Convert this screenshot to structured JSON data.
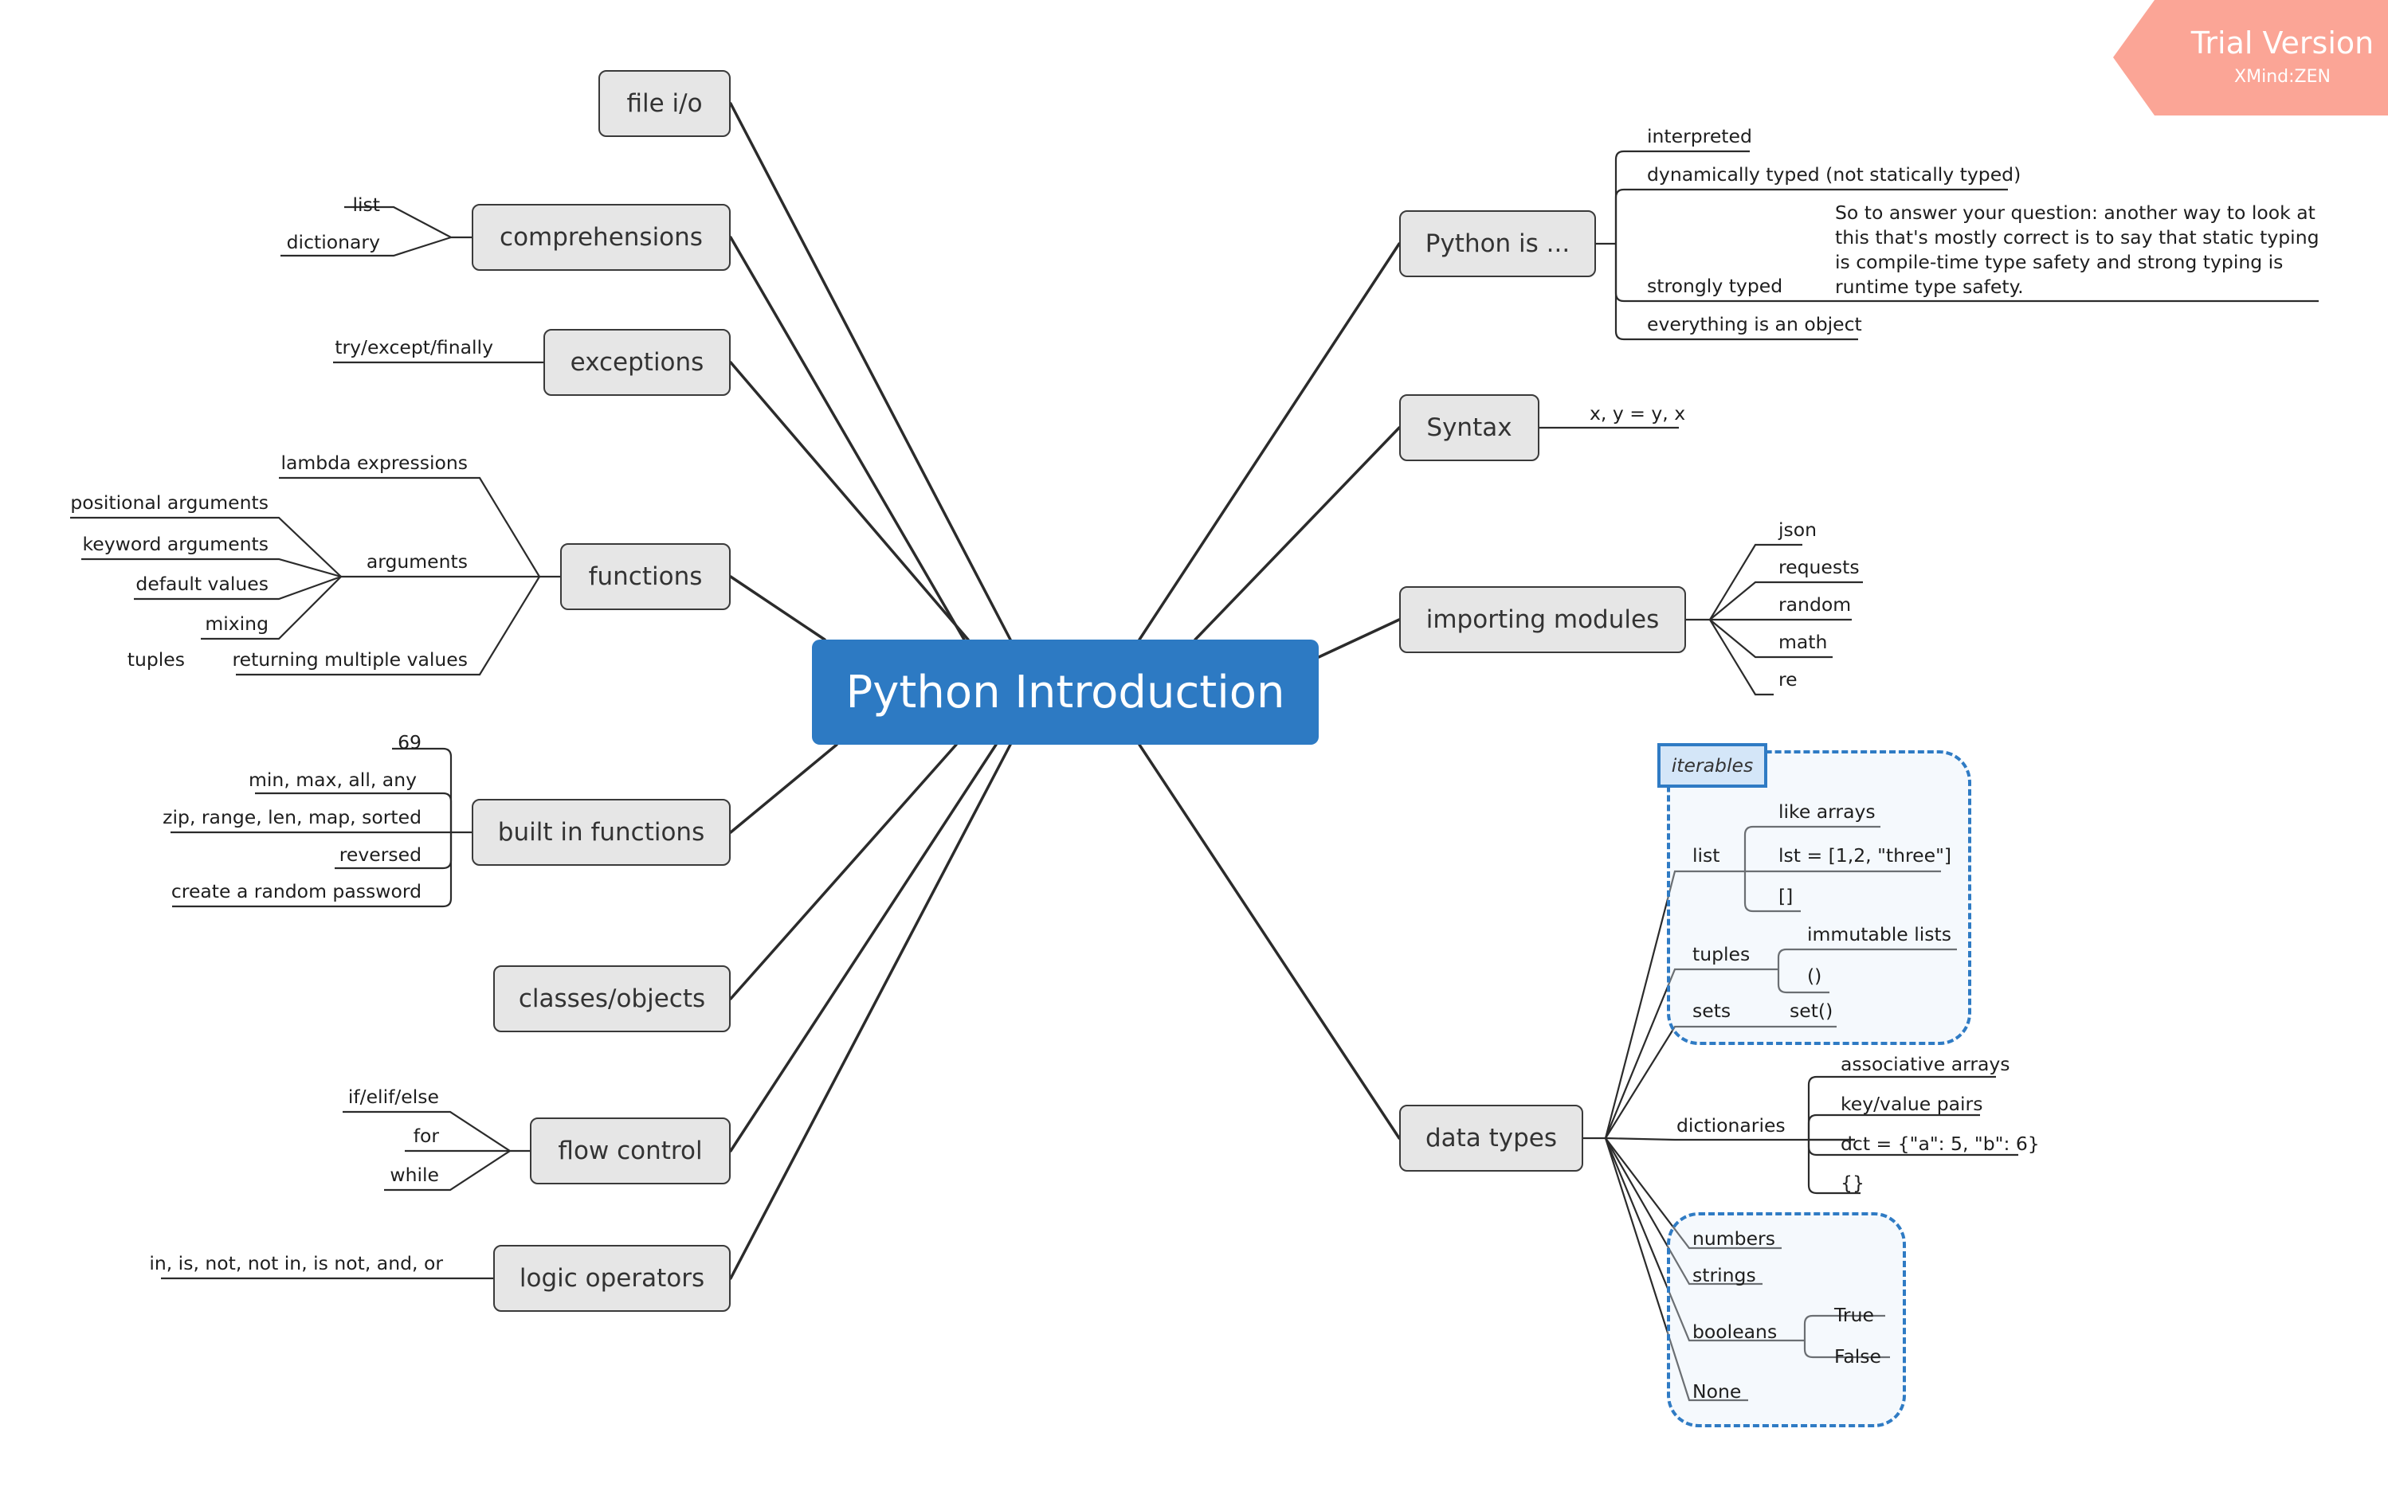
{
  "watermark": {
    "title": "Trial Version",
    "subtitle": "XMind:ZEN",
    "color": "#fba596"
  },
  "central": {
    "label": "Python Introduction",
    "color": "#2d7ac3"
  },
  "left_topics": {
    "file_io": {
      "label": "file i/o"
    },
    "comprehensions": {
      "label": "comprehensions",
      "children": [
        "list",
        "dictionary"
      ]
    },
    "exceptions": {
      "label": "exceptions",
      "children": [
        "try/except/finally"
      ]
    },
    "functions": {
      "label": "functions",
      "children": {
        "lambda": "lambda expressions",
        "arguments": {
          "label": "arguments",
          "children": [
            "positional arguments",
            "keyword arguments",
            "default values",
            "mixing"
          ]
        },
        "returning": {
          "label": "returning multiple values",
          "children": [
            "tuples"
          ]
        }
      }
    },
    "built_in": {
      "label": "built in functions",
      "children": [
        "69",
        "min, max, all, any",
        "zip, range, len, map, sorted",
        "reversed",
        "create a random password"
      ]
    },
    "classes": {
      "label": "classes/objects"
    },
    "flow_control": {
      "label": "flow control",
      "children": [
        "if/elif/else",
        "for",
        "while"
      ]
    },
    "logic": {
      "label": "logic operators",
      "children": [
        "in, is, not, not in, is not, and, or"
      ]
    }
  },
  "right_topics": {
    "python_is": {
      "label": "Python is ...",
      "children": {
        "interpreted": "interpreted",
        "dynamic": "dynamically typed (not statically typed)",
        "strong": "strongly typed",
        "strong_note": "So to answer your question: another way to look at this that's mostly correct is to say that static typing is compile-time type safety and strong typing is runtime type safety.",
        "object": "everything is an object"
      }
    },
    "syntax": {
      "label": "Syntax",
      "children": [
        "x, y = y, x"
      ]
    },
    "importing": {
      "label": "importing modules",
      "children": [
        "json",
        "requests",
        "random",
        "math",
        "re"
      ]
    },
    "data_types": {
      "label": "data types",
      "iterables_label": "iterables",
      "list": {
        "label": "list",
        "children": [
          "like arrays",
          "lst = [1,2, \"three\"]",
          "[]"
        ]
      },
      "tuples": {
        "label": "tuples",
        "children": [
          "immutable lists",
          "()"
        ]
      },
      "sets": {
        "label": "sets",
        "children": [
          "set()"
        ]
      },
      "dictionaries": {
        "label": "dictionaries",
        "children": [
          "associative arrays",
          "key/value pairs",
          "dct = {\"a\": 5, \"b\": 6}",
          "{}"
        ]
      },
      "numbers": "numbers",
      "strings": "strings",
      "booleans": {
        "label": "booleans",
        "children": [
          "True",
          "False"
        ]
      },
      "none": "None"
    }
  }
}
